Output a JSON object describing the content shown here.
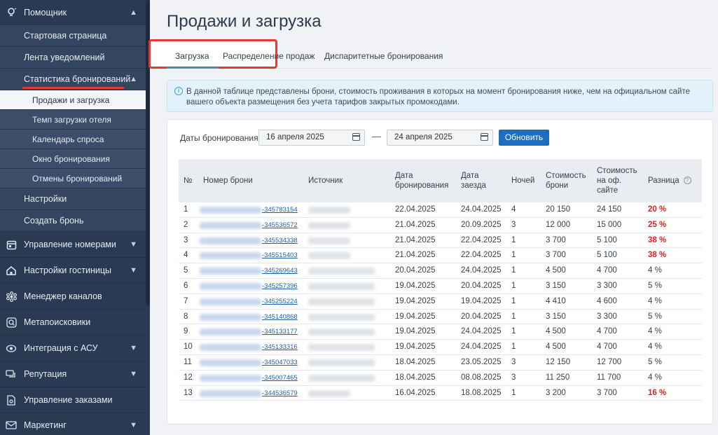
{
  "sidebar": {
    "items": [
      {
        "label": "Помощник",
        "icon": "lightbulb-icon",
        "expanded": true
      },
      {
        "label": "Стартовая страница"
      },
      {
        "label": "Лента уведомлений"
      },
      {
        "label": "Статистика бронирований",
        "expanded": true
      },
      {
        "label": "Продажи и загрузка",
        "active": true
      },
      {
        "label": "Темп загрузки отеля"
      },
      {
        "label": "Календарь спроса"
      },
      {
        "label": "Окно бронирования"
      },
      {
        "label": "Отмены бронирований"
      },
      {
        "label": "Настройки"
      },
      {
        "label": "Создать бронь"
      },
      {
        "label": "Управление номерами",
        "icon": "calendar-icon"
      },
      {
        "label": "Настройки гостиницы",
        "icon": "home-icon"
      },
      {
        "label": "Менеджер каналов",
        "icon": "network-icon"
      },
      {
        "label": "Метапоисковики",
        "icon": "search-icon"
      },
      {
        "label": "Интеграция с АСУ",
        "icon": "sync-icon"
      },
      {
        "label": "Репутация",
        "icon": "chat-icon"
      },
      {
        "label": "Управление заказами",
        "icon": "document-icon"
      },
      {
        "label": "Маркетинг",
        "icon": "mail-icon"
      }
    ]
  },
  "page": {
    "title": "Продажи и загрузка",
    "tabs": [
      "Загрузка",
      "Распределение продаж",
      "Диспаритетные бронирования"
    ],
    "info": "В данной таблице представлены брони, стоимость проживания в которых на момент бронирования ниже, чем на официальном сайте вашего объекта размещения без учета тарифов закрытых промокодами.",
    "filter_label": "Даты бронирования",
    "date_from": "16 апреля 2025",
    "date_to": "24 апреля 2025",
    "dash": "—",
    "refresh": "Обновить"
  },
  "table": {
    "headers": {
      "n": "№",
      "booking": "Номер брони",
      "source": "Источник",
      "date_booking": "Дата бронирования",
      "date_arrival": "Дата заезда",
      "nights": "Ночей",
      "cost": "Стоимость брони",
      "cost_site": "Стоимость на оф. сайте",
      "diff": "Разница",
      "help": "?"
    },
    "rows": [
      {
        "n": "1",
        "id": "-345783154",
        "db": "22.04.2025",
        "da": "24.04.2025",
        "nights": "4",
        "cost": "20 150",
        "site": "24 150",
        "diff": "20 %",
        "hl": true
      },
      {
        "n": "2",
        "id": "-345536572",
        "db": "21.04.2025",
        "da": "20.09.2025",
        "nights": "3",
        "cost": "12 000",
        "site": "15 000",
        "diff": "25 %",
        "hl": true
      },
      {
        "n": "3",
        "id": "-345534338",
        "db": "21.04.2025",
        "da": "22.04.2025",
        "nights": "1",
        "cost": "3 700",
        "site": "5 100",
        "diff": "38 %",
        "hl": true
      },
      {
        "n": "4",
        "id": "-345515403",
        "db": "21.04.2025",
        "da": "22.04.2025",
        "nights": "1",
        "cost": "3 700",
        "site": "5 100",
        "diff": "38 %",
        "hl": true
      },
      {
        "n": "5",
        "id": "-345269643",
        "db": "20.04.2025",
        "da": "24.04.2025",
        "nights": "1",
        "cost": "4 500",
        "site": "4 700",
        "diff": "4 %",
        "hl": false
      },
      {
        "n": "6",
        "id": "-345257396",
        "db": "19.04.2025",
        "da": "20.04.2025",
        "nights": "1",
        "cost": "3 150",
        "site": "3 300",
        "diff": "5 %",
        "hl": false
      },
      {
        "n": "7",
        "id": "-345255224",
        "db": "19.04.2025",
        "da": "19.04.2025",
        "nights": "1",
        "cost": "4 410",
        "site": "4 600",
        "diff": "4 %",
        "hl": false
      },
      {
        "n": "8",
        "id": "-345140868",
        "db": "19.04.2025",
        "da": "20.04.2025",
        "nights": "1",
        "cost": "3 150",
        "site": "3 300",
        "diff": "5 %",
        "hl": false
      },
      {
        "n": "9",
        "id": "-345133177",
        "db": "19.04.2025",
        "da": "24.04.2025",
        "nights": "1",
        "cost": "4 500",
        "site": "4 700",
        "diff": "4 %",
        "hl": false
      },
      {
        "n": "10",
        "id": "-345133316",
        "db": "19.04.2025",
        "da": "24.04.2025",
        "nights": "1",
        "cost": "4 500",
        "site": "4 700",
        "diff": "4 %",
        "hl": false
      },
      {
        "n": "11",
        "id": "-345047033",
        "db": "18.04.2025",
        "da": "23.05.2025",
        "nights": "3",
        "cost": "12 150",
        "site": "12 700",
        "diff": "5 %",
        "hl": false
      },
      {
        "n": "12",
        "id": "-345007465",
        "db": "18.04.2025",
        "da": "08.08.2025",
        "nights": "3",
        "cost": "11 250",
        "site": "11 700",
        "diff": "4 %",
        "hl": false
      },
      {
        "n": "13",
        "id": "-344536579",
        "db": "16.04.2025",
        "da": "18.08.2025",
        "nights": "1",
        "cost": "3 200",
        "site": "3 700",
        "diff": "16 %",
        "hl": true
      }
    ]
  },
  "colors": {
    "sidebar": "#2a3a52",
    "accent": "#1e6dbf",
    "highlight": "#e53935",
    "diff_red": "#e02020"
  }
}
